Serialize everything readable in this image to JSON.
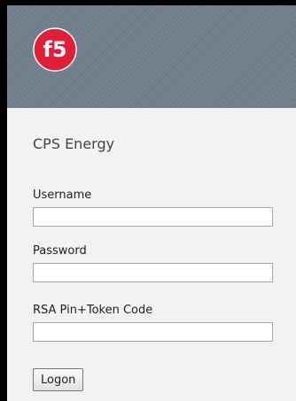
{
  "company_name": "CPS Energy",
  "logo": {
    "text": "f5",
    "icon": "f5-logo-icon"
  },
  "form": {
    "username_label": "Username",
    "username_value": "",
    "password_label": "Password",
    "password_value": "",
    "token_label": "RSA Pin+Token Code",
    "token_value": "",
    "logon_button": "Logon"
  },
  "colors": {
    "header": "#6f7c8a",
    "logo_red": "#e21d38",
    "background": "#f2f2f2"
  }
}
